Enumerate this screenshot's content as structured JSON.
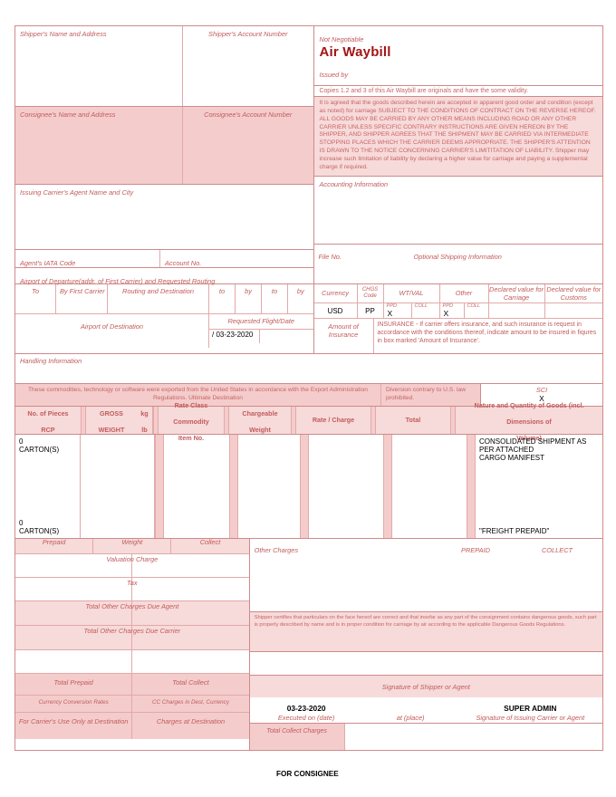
{
  "document": {
    "title": "Air Waybill",
    "not_negotiable": "Not Negotiable",
    "issued_by": "Issued by",
    "copies_note": "Copies 1.2 and 3 of this Air Waybill are originals and have the some validity.",
    "conditions": "It is agreed that the goods described herein are accepted in apparent good order and condition (except as noted) for carriage SUBJECT TO THE CONDITIONS OF CONTRACT ON THE REVERSE HEREOF. ALL GOODS MAY BE CARRIED BY ANY OTHER MEANS INCLUDING ROAD OR ANY OTHER CARRIER UNLESS SPECIFIC CONTRARY INSTRUCTIONS ARE GIVEN HEREON BY THE SHIPPER, AND SHIPPER AGREES THAT THE SHIPMENT MAY BE CARRIED VIA INTERMEDIATE STOPPING PLACES WHICH THE CARRIER DEEMS APPROPRIATE. THE SHIPPER'S ATTENTION IS DRAWN TO THE NOTICE CONCERNING CARRIER'S LIMITITATION OF LIABILITY. Shipper may increase such limitation of liability by declaring a higher value for carriage and paying a supplemental charge if required.",
    "for_consignee": "FOR CONSIGNEE"
  },
  "shipper": {
    "name_label": "Shipper's Name and Address",
    "account_label": "Shipper's Account Number",
    "name_value": "",
    "account_value": ""
  },
  "consignee": {
    "name_label": "Consignee's Name and Address",
    "account_label": "Consignee's Account Number",
    "name_value": "",
    "account_value": ""
  },
  "agent": {
    "name_city_label": "Issuing Carrier's Agent Name and City",
    "iata_label": "Agent's IATA Code",
    "account_label": "Account No.",
    "name_city_value": "",
    "iata_value": "",
    "account_value": ""
  },
  "accounting": {
    "label": "Accounting Information",
    "value": ""
  },
  "routing": {
    "departure_label": "Airport of Departure(addr. of First Carrier) and Requested Routing",
    "departure_value": "",
    "file_no_label": "File No.",
    "file_no_value": "",
    "optional_shipping_label": "Optional Shipping Information",
    "optional_shipping_value": "",
    "columns": [
      "To",
      "By First Carrier",
      "Routing and Destination",
      "to",
      "by",
      "to",
      "by"
    ],
    "values": [
      "",
      "",
      "",
      "",
      "",
      "",
      ""
    ],
    "destination_label": "Airport of Destination",
    "destination_value": "",
    "flight_date_label": "Requested Flight/Date",
    "flight_date_value": "/ 03-23-2020",
    "flight_date_value2": ""
  },
  "charges_header": {
    "currency_label": "Currency",
    "currency_value": "USD",
    "chgs_code_label": "CHGS Code",
    "chgs_code_value": "PP",
    "wtval_label": "WT/VAL",
    "other_label": "Other",
    "ppd_label": "PPD",
    "coll_label": "COLL",
    "wtval_ppd_mark": "X",
    "wtval_coll_mark": "",
    "other_ppd_mark": "X",
    "other_coll_mark": "",
    "declared_carriage_label": "Declared value for Carriage",
    "declared_carriage_value": "",
    "declared_customs_label": "Declared value for Customs",
    "declared_customs_value": "",
    "amount_insurance_label": "Amount of Insurance",
    "amount_insurance_value": "",
    "insurance_note": "INSURANCE - If carrier offers insurance, and such insurance is request in accordance with the conditions thereof, indicate amount to be insured in fiqures in box marked 'Amount of Insurance'."
  },
  "handling": {
    "label": "Handling Information",
    "value": "",
    "export_note": "These commodities, technology or software were exported from the United States in accordance with the Export Administration Regulations. Ultimate Destination",
    "diversion_note": "Diversion contrary to U.S. law prohibited.",
    "sci_label": "SCI",
    "sci_value": "X"
  },
  "goods_table": {
    "columns": [
      "No. of Pieces RCP",
      "GROSS WEIGHT",
      "kg lb",
      "Rate Class Commodity Item No.",
      "Chargeable Weight",
      "Rate / Charge",
      "Total",
      "Nature and Quantity of Goods (incl. Dimensions of Volume)"
    ],
    "col_lines": {
      "pieces": [
        "No. of Pieces",
        "RCP"
      ],
      "gross": [
        "GROSS",
        "WEIGHT"
      ],
      "kglb": [
        "kg",
        "lb"
      ],
      "rateclass": [
        "Rate Class",
        "Commodity",
        "Item No."
      ],
      "chargeable": [
        "Chargeable",
        "Weight"
      ],
      "rate": [
        "Rate / Charge"
      ],
      "total": [
        "Total"
      ],
      "nature": [
        "Nature and Quantity of Goods (incl. Dimensions of",
        "Volume)"
      ]
    },
    "row": {
      "pieces_top": "0",
      "pieces_top2": "CARTON(S)",
      "pieces_bottom": "0",
      "pieces_bottom2": "CARTON(S)",
      "gross_weight": "",
      "kg_lb": "",
      "rate_class": "",
      "chargeable_weight": "",
      "rate_charge": "",
      "total": "",
      "nature_line1": "CONSOLIDATED SHIPMENT AS PER ATTACHED",
      "nature_line2": "CARGO MANIFEST",
      "nature_footer": "\"FREIGHT PREPAID\""
    }
  },
  "charges": {
    "prepaid_label": "Prepaid",
    "weight_label": "Weight",
    "collect_label": "Collect",
    "valuation_label": "Valuation Charge",
    "tax_label": "Tax",
    "total_other_agent_label": "Total Other Charges Due Agent",
    "total_other_carrier_label": "Total Other Charges Due Carrier",
    "total_prepaid_label": "Total Prepaid",
    "total_collect_label": "Total Collect",
    "currency_conv_label": "Currency Conversion Rates",
    "cc_charges_label": "CC Charges in Dest, Currency",
    "carrier_use_label": "For Carrier's Use Only at Destination",
    "charges_at_dest_label": "Charges at Destination",
    "total_collect_charges_label": "Total Collect Charges",
    "values": {
      "prepaid_weight": "",
      "collect_weight": "",
      "prepaid_valuation": "",
      "collect_valuation": "",
      "prepaid_tax": "",
      "collect_tax": "",
      "prepaid_agent": "",
      "collect_agent": "",
      "prepaid_carrier": "",
      "collect_carrier": "",
      "total_prepaid": "",
      "total_collect": "",
      "currency_conv": "",
      "cc_charges": "",
      "charges_at_dest": "",
      "total_collect_charges": ""
    }
  },
  "other_charges": {
    "label": "Other Charges",
    "prepaid_label": "PREPAID",
    "collect_label": "COLLECT",
    "value": ""
  },
  "signatures": {
    "shipper_cert": "Shipper certifies that particulars on the face hereof are correct and that insofar as any part of the consignment contains dangerous goods, such part is properly described by name and is in proper condition for carriage by air according to the applicable Dangerous Goods Regulations.",
    "shipper_sign_label": "Signature of Shipper or Agent",
    "executed_on_label": "Executed on (date)",
    "at_place_label": "at (place)",
    "issuing_sign_label": "Signature of Issuing Carrier or Agent",
    "executed_date": "03-23-2020",
    "at_place_value": "",
    "issuing_signature": "SUPER ADMIN"
  },
  "colors": {
    "accent_text": "#c25b5b",
    "title": "#a31515",
    "pink_fill": "#f4cccc",
    "border": "#cf8a8a"
  }
}
